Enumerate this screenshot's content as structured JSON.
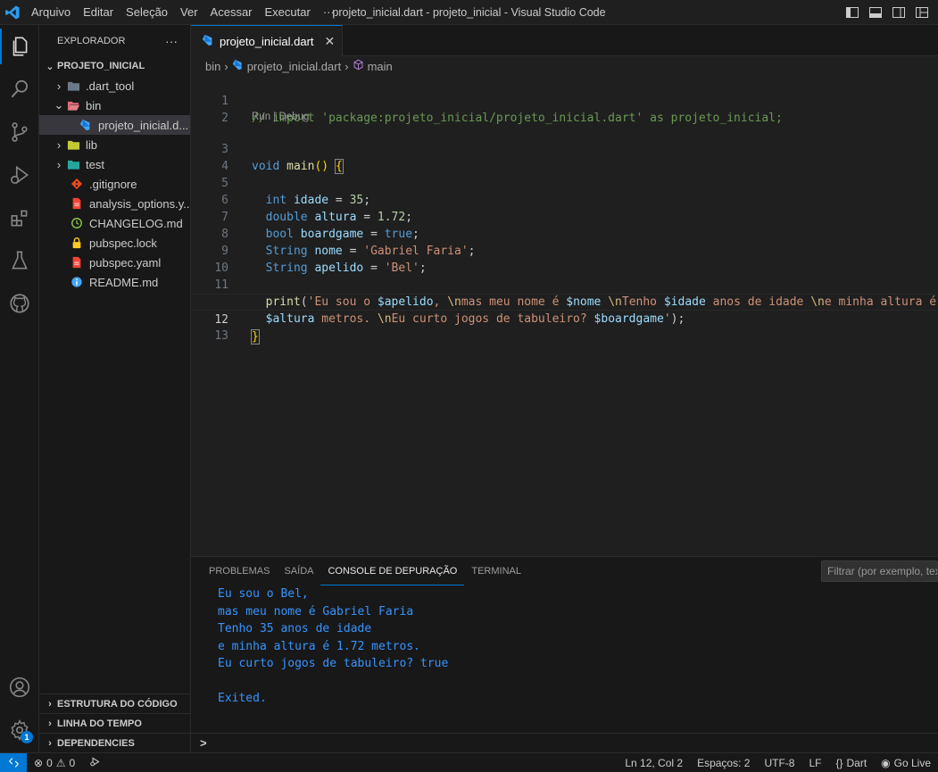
{
  "titlebar": {
    "menu": [
      "Arquivo",
      "Editar",
      "Seleção",
      "Ver",
      "Acessar",
      "Executar",
      "···"
    ],
    "window_title": "projeto_inicial.dart - projeto_inicial - Visual Studio Code"
  },
  "sidebar": {
    "header": "EXPLORADOR",
    "header_more": "···",
    "project": "PROJETO_INICIAL",
    "items": [
      {
        "label": ".dart_tool",
        "icon": "folder-icon"
      },
      {
        "label": "bin",
        "icon": "folder-open-icon"
      },
      {
        "label": "projeto_inicial.d...",
        "icon": "dart-icon"
      },
      {
        "label": "lib",
        "icon": "folder-icon"
      },
      {
        "label": "test",
        "icon": "folder-icon"
      },
      {
        "label": ".gitignore",
        "icon": "git-icon"
      },
      {
        "label": "analysis_options.y...",
        "icon": "yaml-icon"
      },
      {
        "label": "CHANGELOG.md",
        "icon": "changelog-icon"
      },
      {
        "label": "pubspec.lock",
        "icon": "lock-icon"
      },
      {
        "label": "pubspec.yaml",
        "icon": "yaml-icon"
      },
      {
        "label": "README.md",
        "icon": "info-icon"
      }
    ],
    "bottom_sections": [
      "ESTRUTURA DO CÓDIGO",
      "LINHA DO TEMPO",
      "DEPENDENCIES"
    ]
  },
  "editor": {
    "tab_label": "projeto_inicial.dart",
    "tab_close": "✕",
    "breadcrumb": [
      "bin",
      "projeto_inicial.dart",
      "main"
    ],
    "codelens": "Run | Debug",
    "line_numbers": [
      "1",
      "2",
      "3",
      "4",
      "5",
      "6",
      "7",
      "8",
      "9",
      "10",
      "11",
      "",
      "12",
      "13"
    ]
  },
  "panel": {
    "tabs": [
      "PROBLEMAS",
      "SAÍDA",
      "CONSOLE DE DEPURAÇÃO",
      "TERMINAL"
    ],
    "active_tab": "CONSOLE DE DEPURAÇÃO",
    "filter_placeholder": "Filtrar (por exemplo, tex",
    "console_lines": [
      "Eu sou o Bel,",
      "mas meu nome é Gabriel Faria",
      "Tenho 35 anos de idade",
      "e minha altura é 1.72 metros.",
      "Eu curto jogos de tabuleiro? true",
      "",
      "Exited."
    ],
    "repl_prompt": ">"
  },
  "statusbar": {
    "errors": "0",
    "warnings": "0",
    "position": "Ln 12, Col 2",
    "spaces": "Espaços: 2",
    "encoding": "UTF-8",
    "eol": "LF",
    "language": "Dart",
    "golive": "Go Live"
  },
  "activity_badge": "1",
  "colors": {
    "accent": "#0078d4",
    "console_text": "#3794ff"
  }
}
